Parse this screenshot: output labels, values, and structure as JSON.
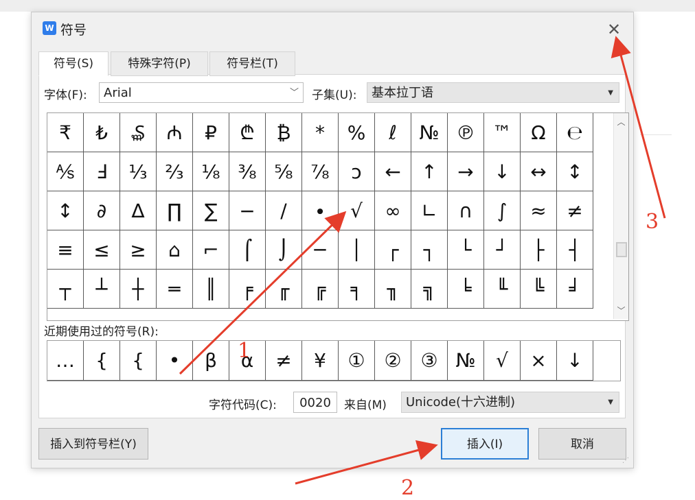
{
  "dialog": {
    "title": "符号",
    "app_icon": "W",
    "close_glyph": "✕",
    "tabs": [
      {
        "label": "符号(S)",
        "active": true
      },
      {
        "label": "特殊字符(P)",
        "active": false
      },
      {
        "label": "符号栏(T)",
        "active": false
      }
    ],
    "font_label": "字体(F):",
    "font_value": "Arial",
    "subset_label": "子集(U):",
    "subset_value": "基本拉丁语",
    "symbol_rows": [
      [
        "₹",
        "₺",
        "₷",
        "₼",
        "₽",
        "₾",
        "₿",
        "*",
        "%",
        "ℓ",
        "№",
        "℗",
        "™",
        "Ω",
        "℮"
      ],
      [
        "⅍",
        "Ⅎ",
        "⅓",
        "⅔",
        "⅛",
        "⅜",
        "⅝",
        "⅞",
        "ↄ",
        "←",
        "↑",
        "→",
        "↓",
        "↔",
        "↕"
      ],
      [
        "↕",
        "∂",
        "∆",
        "∏",
        "∑",
        "−",
        "∕",
        "∙",
        "√",
        "∞",
        "∟",
        "∩",
        "∫",
        "≈",
        "≠"
      ],
      [
        "≡",
        "≤",
        "≥",
        "⌂",
        "⌐",
        "⌠",
        "⌡",
        "─",
        "│",
        "┌",
        "┐",
        "└",
        "┘",
        "├",
        "┤"
      ],
      [
        "┬",
        "┴",
        "┼",
        "═",
        "║",
        "╒",
        "╓",
        "╔",
        "╕",
        "╖",
        "╗",
        "╘",
        "╙",
        "╚",
        "╛"
      ]
    ],
    "recent_label": "近期使用过的符号(R):",
    "recent_symbols": [
      "…",
      "{",
      "{",
      "•",
      "β",
      "α",
      "≠",
      "¥",
      "①",
      "②",
      "③",
      "№",
      "√",
      "×",
      "↓"
    ],
    "char_code_label": "字符代码(C):",
    "char_code_value": "0020",
    "from_label": "来自(M)",
    "from_value": "Unicode(十六进制)",
    "insert_to_bar_button": "插入到符号栏(Y)",
    "insert_button": "插入(I)",
    "cancel_button": "取消"
  },
  "annotations": {
    "numbers": [
      "1",
      "2",
      "3"
    ],
    "color": "#e43d2b"
  },
  "colors": {
    "dialog_bg": "#f0f0f0",
    "primary_border": "#2b7fd6",
    "annotation_red": "#e43d2b"
  }
}
